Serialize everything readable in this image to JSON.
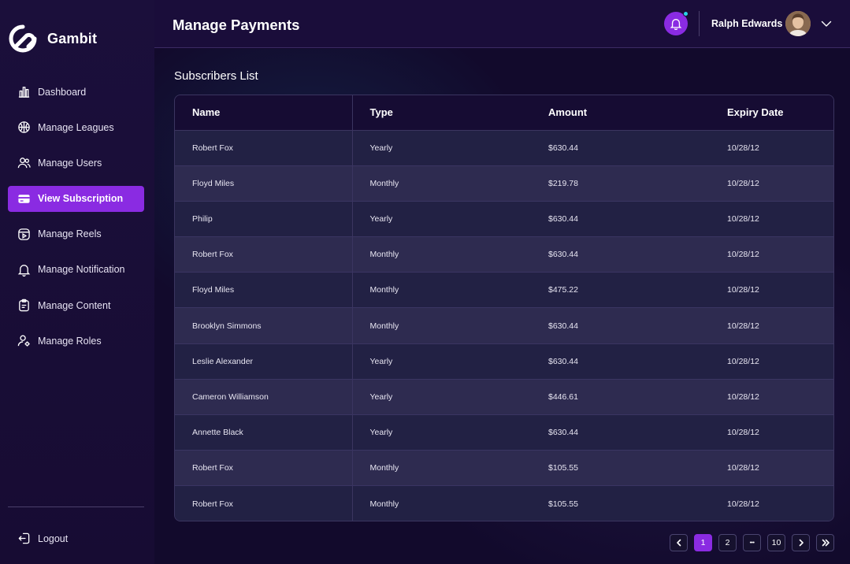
{
  "app": {
    "name": "Gambit"
  },
  "sidebar": {
    "items": [
      {
        "label": "Dashboard",
        "icon": "bar-chart-icon",
        "active": false
      },
      {
        "label": "Manage Leagues",
        "icon": "basketball-icon",
        "active": false
      },
      {
        "label": "Manage Users",
        "icon": "users-icon",
        "active": false
      },
      {
        "label": "View Subscription",
        "icon": "card-icon",
        "active": true
      },
      {
        "label": "Manage Reels",
        "icon": "play-icon",
        "active": false
      },
      {
        "label": "Manage Notification",
        "icon": "bell-icon",
        "active": false
      },
      {
        "label": "Manage Content",
        "icon": "clipboard-icon",
        "active": false
      },
      {
        "label": "Manage Roles",
        "icon": "user-gear-icon",
        "active": false
      }
    ],
    "logout_label": "Logout"
  },
  "header": {
    "title": "Manage Payments",
    "user_name": "Ralph Edwards"
  },
  "main": {
    "section_title": "Subscribers List",
    "table": {
      "columns": [
        "Name",
        "Type",
        "Amount",
        "Expiry Date"
      ],
      "rows": [
        [
          "Robert Fox",
          "Yearly",
          "$630.44",
          "10/28/12"
        ],
        [
          "Floyd Miles",
          "Monthly",
          "$219.78",
          "10/28/12"
        ],
        [
          "Philip",
          "Yearly",
          "$630.44",
          "10/28/12"
        ],
        [
          "Robert Fox",
          "Monthly",
          "$630.44",
          "10/28/12"
        ],
        [
          "Floyd Miles",
          "Monthly",
          "$475.22",
          "10/28/12"
        ],
        [
          "Brooklyn Simmons",
          "Monthly",
          "$630.44",
          "10/28/12"
        ],
        [
          "Leslie Alexander",
          "Yearly",
          "$630.44",
          "10/28/12"
        ],
        [
          "Cameron Williamson",
          "Yearly",
          "$446.61",
          "10/28/12"
        ],
        [
          "Annette Black",
          "Yearly",
          "$630.44",
          "10/28/12"
        ],
        [
          "Robert Fox",
          "Monthly",
          "$105.55",
          "10/28/12"
        ],
        [
          "Robert Fox",
          "Monthly",
          "$105.55",
          "10/28/12"
        ]
      ]
    },
    "pagination": {
      "pages": [
        "1",
        "2",
        "•••",
        "10"
      ],
      "current": "1"
    }
  },
  "colors": {
    "accent": "#8a2be2",
    "notification_dot": "#29d3e6",
    "sidebar_bg": "#1b0f3b",
    "main_bg": "#120a2c"
  }
}
